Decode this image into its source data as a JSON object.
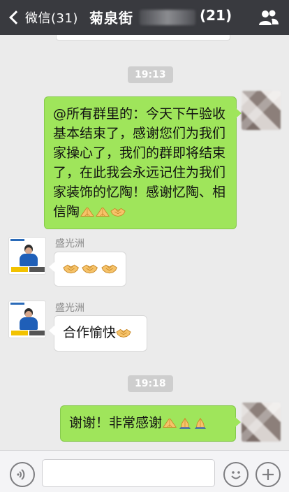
{
  "header": {
    "back_label": "微信(31)",
    "title": "菊泉街",
    "member_count": "(21)"
  },
  "messages": [
    {
      "type": "time",
      "text": "19:13"
    },
    {
      "type": "outgoing",
      "text": "@所有群里的：今天下午验收基本结束了，感谢您们为我们家操心了，我们的群即将结束了，在此我会永远记住为我们家装饰的忆陶！感谢忆陶、相信陶",
      "emojis": [
        "folded-hands",
        "folded-hands",
        "handshake"
      ]
    },
    {
      "type": "incoming",
      "sender": "盛光洲",
      "text": "",
      "emojis": [
        "handshake",
        "handshake",
        "handshake"
      ]
    },
    {
      "type": "incoming",
      "sender": "盛光洲",
      "text": "合作愉快",
      "emojis": [
        "handshake"
      ]
    },
    {
      "type": "time",
      "text": "19:18"
    },
    {
      "type": "outgoing",
      "text": "谢谢！非常感谢",
      "emojis": [
        "folded-hands",
        "praying-hands",
        "praying-hands"
      ]
    }
  ],
  "icons": {
    "back": "chevron-left-icon",
    "members": "group-icon",
    "voice": "voice-icon",
    "emoji": "emoji-icon",
    "more": "plus-icon"
  },
  "colors": {
    "header_bg": "#393a3f",
    "chat_bg": "#ebebeb",
    "outgoing_bubble": "#9fe55b",
    "incoming_bubble": "#ffffff",
    "timestamp_bg": "#cecece"
  }
}
